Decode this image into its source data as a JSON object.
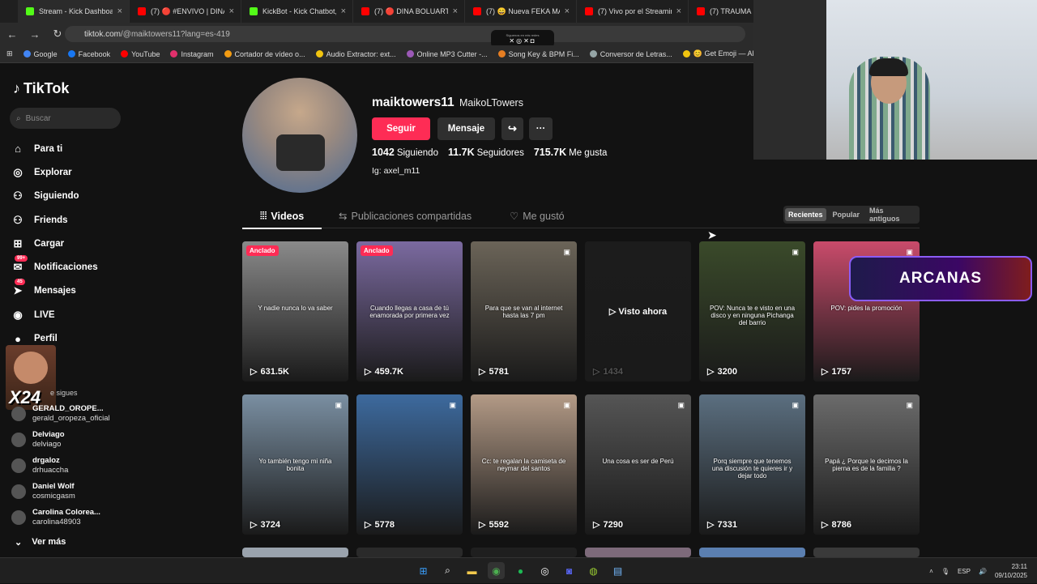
{
  "browser": {
    "tabs": [
      {
        "title": "Stream - Kick Dashboard",
        "color": "#53fc18"
      },
      {
        "title": "(7) 🔴 #ENVIVO | DINA B",
        "color": "#ff0000"
      },
      {
        "title": "KickBot - Kick Chatbot, Al",
        "color": "#53fc18"
      },
      {
        "title": "(7) 🔴 DINA BOLUARTE: C",
        "color": "#ff0000"
      },
      {
        "title": "(7) 😄 Nueva FEKA MANS",
        "color": "#ff0000"
      },
      {
        "title": "(7) Vivo por el Streaming",
        "color": "#ff0000"
      },
      {
        "title": "(7) TRAUMA M",
        "color": "#ff0000"
      }
    ],
    "url_main": "tiktok.com",
    "url_rest": "/@maiktowers11?lang=es-419",
    "overlay_small": "Síguenos en mis redes",
    "overlay_icons": "✕◎✕◘",
    "bookmarks": [
      "Google",
      "Facebook",
      "YouTube",
      "Instagram",
      "Cortador de vídeo o...",
      "Audio Extractor: ext...",
      "Online MP3 Cutter -...",
      "Song Key & BPM Fi...",
      "Conversor de Letras...",
      "😊 Get Emoji — All...",
      "pnkz_Ofi"
    ]
  },
  "sidebar": {
    "logo": "TikTok",
    "search_placeholder": "Buscar",
    "menu": [
      {
        "label": "Para ti",
        "icon": "⌂"
      },
      {
        "label": "Explorar",
        "icon": "◎"
      },
      {
        "label": "Siguiendo",
        "icon": "⚇"
      },
      {
        "label": "Friends",
        "icon": "⚇"
      },
      {
        "label": "Cargar",
        "icon": "⊞"
      },
      {
        "label": "Notificaciones",
        "icon": "✉",
        "badge": "99+"
      },
      {
        "label": "Mensajes",
        "icon": "➤",
        "badge": "45"
      },
      {
        "label": "LIVE",
        "icon": "◉"
      },
      {
        "label": "Perfil",
        "icon": "●"
      }
    ],
    "following_title": "Cuentas que sigues",
    "following_visible_title": "e sigues",
    "following": [
      {
        "name": "GERALD_OROPE...",
        "user": "gerald_oropeza_oficial"
      },
      {
        "name": "Delviago",
        "user": "delviago"
      },
      {
        "name": "drgaloz",
        "user": "drhuaccha"
      },
      {
        "name": "Daniel Wolf",
        "user": "cosmicgasm"
      },
      {
        "name": "Carolina Colorea...",
        "user": "carolina48903"
      }
    ],
    "ver_mas": "Ver más",
    "overlay_label": "X24"
  },
  "profile": {
    "username": "maiktowers11",
    "display_name": "MaikoLTowers",
    "follow_label": "Seguir",
    "message_label": "Mensaje",
    "following_count": "1042",
    "following_label": "Siguiendo",
    "followers_count": "11.7K",
    "followers_label": "Seguidores",
    "likes_count": "715.7K",
    "likes_label": "Me gusta",
    "bio": "Ig: axel_m11"
  },
  "tabs": {
    "videos": "Videos",
    "shared": "Publicaciones compartidas",
    "liked": "Me gustó"
  },
  "sort": [
    "Recientes",
    "Popular",
    "Más antiguos"
  ],
  "videos": [
    {
      "views": "631.5K",
      "pinned": "Anclado",
      "caption": "Y nadie nunca lo va saber",
      "bg": "#8a8a8a"
    },
    {
      "views": "459.7K",
      "pinned": "Anclado",
      "caption": "Cuando llegas a casa de tú enamorada por primera vez",
      "bg": "#7b6aa0"
    },
    {
      "views": "5781",
      "caption": "Para que se van al internet hasta las 7 pm",
      "bg": "#6b6458"
    },
    {
      "views": "1434",
      "caption": "Visto ahora",
      "bg": "#1c1c1c",
      "watched": true
    },
    {
      "views": "3200",
      "caption": "POV: Nunca te e visto en una disco y en ninguna Pichanga del barrio",
      "bg": "#3a4a2a"
    },
    {
      "views": "1757",
      "caption": "POV: pides la promoción",
      "bg": "#c94b6b"
    },
    {
      "views": "3724",
      "caption": "Yo también tengo mi niña bonita",
      "bg": "#7a8fa2"
    },
    {
      "views": "5778",
      "caption": "",
      "bg": "#3d6a9e"
    },
    {
      "views": "5592",
      "caption": "Cc: te regalan la camiseta de neymar del santos",
      "bg": "#b39a86"
    },
    {
      "views": "7290",
      "caption": "Una cosa es ser de Perú",
      "bg": "#555555"
    },
    {
      "views": "7331",
      "caption": "Porq siempre que tenemos una discusión te quieres ir y dejar todo",
      "bg": "#5b6f80"
    },
    {
      "views": "8786",
      "caption": "Papá ¿ Porque le decimos la pierna es de la familia ?",
      "bg": "#6b6b6b"
    }
  ],
  "stream_overlay": {
    "arcanas": "ARCANAS"
  },
  "taskbar": {
    "lang": "ESP",
    "time": "23:11",
    "date": "09/10/2025"
  }
}
